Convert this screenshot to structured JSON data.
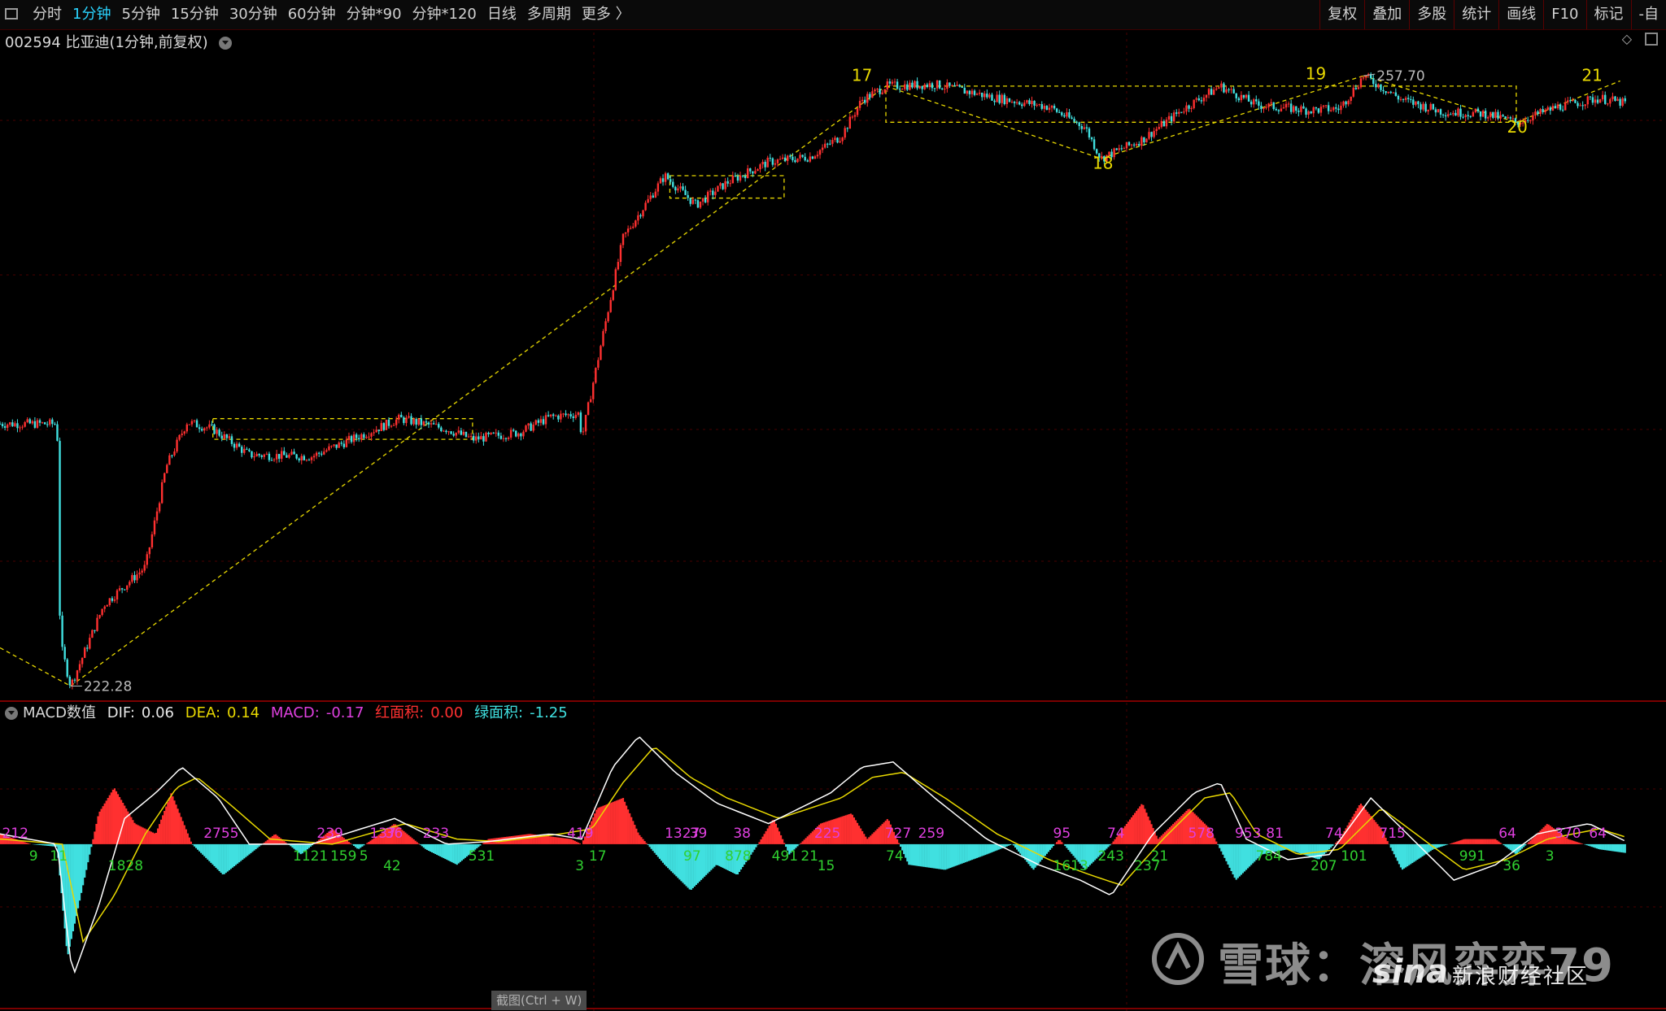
{
  "toolbar": {
    "periods": [
      "分时",
      "1分钟",
      "5分钟",
      "15分钟",
      "30分钟",
      "60分钟",
      "分钟*90",
      "分钟*120",
      "日线",
      "多周期",
      "更多 〉"
    ],
    "active_period": "1分钟",
    "tools": [
      "复权",
      "叠加",
      "多股",
      "统计",
      "画线",
      "F10",
      "标记",
      "-自"
    ]
  },
  "title": {
    "code": "002594",
    "name": "比亚迪(1分钟,前复权)"
  },
  "macd_header": {
    "name": "MACD数值",
    "dif_label": "DIF:",
    "dif": "0.06",
    "dea_label": "DEA:",
    "dea": "0.14",
    "macd_label": "MACD:",
    "macd": "-0.17",
    "red_label": "红面积:",
    "red": "0.00",
    "green_label": "绿面积:",
    "green": "-1.25"
  },
  "colors": {
    "up": "#ff3030",
    "down": "#40e0e0",
    "dif_line": "#ffffff",
    "dea_line": "#e8d800",
    "annotation": "#e8d800",
    "macd_red_label": "#e040e0",
    "macd_green_label": "#30d030",
    "grid": "#4a0000"
  },
  "chart_data": [
    {
      "type": "candlestick",
      "title": "002594 比亚迪(1分钟,前复权)",
      "price_labels": [
        {
          "label": "222.28",
          "kind": "low"
        },
        {
          "label": "257.70",
          "kind": "high"
        }
      ],
      "ylim": [
        221.5,
        259.5
      ],
      "path_points": [
        {
          "x": 0,
          "y": 237.5
        },
        {
          "x": 55,
          "y": 237.5
        },
        {
          "x": 58,
          "y": 224.8
        },
        {
          "x": 68,
          "y": 222.28
        },
        {
          "x": 100,
          "y": 227.0
        },
        {
          "x": 140,
          "y": 229.2
        },
        {
          "x": 160,
          "y": 235.0
        },
        {
          "x": 180,
          "y": 237.6
        },
        {
          "x": 205,
          "y": 237.2
        },
        {
          "x": 240,
          "y": 235.7
        },
        {
          "x": 300,
          "y": 235.6
        },
        {
          "x": 385,
          "y": 237.8
        },
        {
          "x": 430,
          "y": 237.2
        },
        {
          "x": 455,
          "y": 236.6
        },
        {
          "x": 500,
          "y": 237.0
        },
        {
          "x": 530,
          "y": 237.9
        },
        {
          "x": 558,
          "y": 238.1
        },
        {
          "x": 560,
          "y": 236.6
        },
        {
          "x": 580,
          "y": 242.5
        },
        {
          "x": 600,
          "y": 248.3
        },
        {
          "x": 640,
          "y": 251.9
        },
        {
          "x": 670,
          "y": 250.2
        },
        {
          "x": 700,
          "y": 251.5
        },
        {
          "x": 740,
          "y": 252.7
        },
        {
          "x": 780,
          "y": 253.0
        },
        {
          "x": 810,
          "y": 254.2
        },
        {
          "x": 830,
          "y": 256.3
        },
        {
          "x": 853,
          "y": 257.1
        },
        {
          "x": 900,
          "y": 257.2
        },
        {
          "x": 960,
          "y": 256.4
        },
        {
          "x": 1010,
          "y": 255.9
        },
        {
          "x": 1045,
          "y": 254.7
        },
        {
          "x": 1060,
          "y": 252.9
        },
        {
          "x": 1100,
          "y": 254.0
        },
        {
          "x": 1140,
          "y": 255.8
        },
        {
          "x": 1175,
          "y": 257.1
        },
        {
          "x": 1210,
          "y": 256.0
        },
        {
          "x": 1260,
          "y": 255.7
        },
        {
          "x": 1290,
          "y": 255.8
        },
        {
          "x": 1313,
          "y": 257.7
        },
        {
          "x": 1350,
          "y": 256.3
        },
        {
          "x": 1390,
          "y": 255.6
        },
        {
          "x": 1430,
          "y": 255.5
        },
        {
          "x": 1460,
          "y": 255.0
        },
        {
          "x": 1500,
          "y": 255.9
        },
        {
          "x": 1540,
          "y": 256.4
        },
        {
          "x": 1565,
          "y": 256.1
        }
      ],
      "annotations": [
        {
          "label": "17"
        },
        {
          "label": "18"
        },
        {
          "label": "19"
        },
        {
          "label": "20"
        },
        {
          "label": "21"
        }
      ]
    },
    {
      "type": "macd",
      "series": [
        {
          "name": "DIF",
          "color": "#ffffff"
        },
        {
          "name": "DEA",
          "color": "#e8d800"
        }
      ],
      "ylim": [
        -3.2,
        2.5
      ],
      "histogram_points": [
        {
          "x": 0,
          "y": 0.2
        },
        {
          "x": 30,
          "y": 0.0
        },
        {
          "x": 55,
          "y": -0.05
        },
        {
          "x": 65,
          "y": -2.2
        },
        {
          "x": 80,
          "y": -0.8
        },
        {
          "x": 95,
          "y": 0.6
        },
        {
          "x": 110,
          "y": 1.1
        },
        {
          "x": 130,
          "y": 0.4
        },
        {
          "x": 150,
          "y": 0.2
        },
        {
          "x": 165,
          "y": 1.0
        },
        {
          "x": 185,
          "y": 0.0
        },
        {
          "x": 215,
          "y": -0.6
        },
        {
          "x": 240,
          "y": -0.2
        },
        {
          "x": 265,
          "y": 0.2
        },
        {
          "x": 290,
          "y": -0.2
        },
        {
          "x": 320,
          "y": 0.3
        },
        {
          "x": 345,
          "y": -0.1
        },
        {
          "x": 380,
          "y": 0.4
        },
        {
          "x": 410,
          "y": -0.1
        },
        {
          "x": 440,
          "y": -0.4
        },
        {
          "x": 470,
          "y": 0.1
        },
        {
          "x": 510,
          "y": 0.2
        },
        {
          "x": 550,
          "y": 0.1
        },
        {
          "x": 560,
          "y": 0.0
        },
        {
          "x": 575,
          "y": 0.7
        },
        {
          "x": 600,
          "y": 0.9
        },
        {
          "x": 615,
          "y": 0.2
        },
        {
          "x": 640,
          "y": -0.4
        },
        {
          "x": 665,
          "y": -0.9
        },
        {
          "x": 690,
          "y": -0.4
        },
        {
          "x": 710,
          "y": -0.6
        },
        {
          "x": 730,
          "y": 0.0
        },
        {
          "x": 745,
          "y": 0.5
        },
        {
          "x": 760,
          "y": -0.2
        },
        {
          "x": 790,
          "y": 0.4
        },
        {
          "x": 820,
          "y": 0.6
        },
        {
          "x": 835,
          "y": 0.1
        },
        {
          "x": 855,
          "y": 0.5
        },
        {
          "x": 875,
          "y": -0.4
        },
        {
          "x": 910,
          "y": -0.5
        },
        {
          "x": 950,
          "y": -0.2
        },
        {
          "x": 975,
          "y": 0.0
        },
        {
          "x": 995,
          "y": -0.5
        },
        {
          "x": 1020,
          "y": 0.1
        },
        {
          "x": 1045,
          "y": -0.5
        },
        {
          "x": 1070,
          "y": 0.0
        },
        {
          "x": 1100,
          "y": 0.8
        },
        {
          "x": 1115,
          "y": 0.1
        },
        {
          "x": 1145,
          "y": 0.7
        },
        {
          "x": 1165,
          "y": 0.3
        },
        {
          "x": 1190,
          "y": -0.7
        },
        {
          "x": 1215,
          "y": -0.2
        },
        {
          "x": 1240,
          "y": -0.1
        },
        {
          "x": 1270,
          "y": -0.3
        },
        {
          "x": 1290,
          "y": 0.1
        },
        {
          "x": 1310,
          "y": 0.8
        },
        {
          "x": 1330,
          "y": 0.3
        },
        {
          "x": 1350,
          "y": -0.5
        },
        {
          "x": 1380,
          "y": -0.1
        },
        {
          "x": 1410,
          "y": 0.1
        },
        {
          "x": 1440,
          "y": 0.1
        },
        {
          "x": 1460,
          "y": -0.2
        },
        {
          "x": 1490,
          "y": 0.4
        },
        {
          "x": 1510,
          "y": 0.1
        },
        {
          "x": 1540,
          "y": -0.1
        },
        {
          "x": 1565,
          "y": -0.17
        }
      ],
      "dif_points": [
        {
          "x": 0,
          "y": 0.2
        },
        {
          "x": 55,
          "y": 0.0
        },
        {
          "x": 70,
          "y": -2.6
        },
        {
          "x": 95,
          "y": -1.2
        },
        {
          "x": 120,
          "y": 0.5
        },
        {
          "x": 150,
          "y": 1.0
        },
        {
          "x": 175,
          "y": 1.5
        },
        {
          "x": 210,
          "y": 0.9
        },
        {
          "x": 240,
          "y": 0.0
        },
        {
          "x": 300,
          "y": 0.0
        },
        {
          "x": 380,
          "y": 0.5
        },
        {
          "x": 430,
          "y": 0.0
        },
        {
          "x": 470,
          "y": 0.05
        },
        {
          "x": 530,
          "y": 0.2
        },
        {
          "x": 560,
          "y": 0.1
        },
        {
          "x": 590,
          "y": 1.5
        },
        {
          "x": 615,
          "y": 2.1
        },
        {
          "x": 650,
          "y": 1.4
        },
        {
          "x": 690,
          "y": 0.8
        },
        {
          "x": 740,
          "y": 0.4
        },
        {
          "x": 800,
          "y": 1.0
        },
        {
          "x": 830,
          "y": 1.5
        },
        {
          "x": 860,
          "y": 1.6
        },
        {
          "x": 900,
          "y": 0.9
        },
        {
          "x": 950,
          "y": 0.1
        },
        {
          "x": 1000,
          "y": -0.4
        },
        {
          "x": 1040,
          "y": -0.7
        },
        {
          "x": 1070,
          "y": -1.0
        },
        {
          "x": 1110,
          "y": 0.2
        },
        {
          "x": 1150,
          "y": 1.0
        },
        {
          "x": 1175,
          "y": 1.2
        },
        {
          "x": 1200,
          "y": 0.1
        },
        {
          "x": 1240,
          "y": -0.3
        },
        {
          "x": 1280,
          "y": -0.2
        },
        {
          "x": 1320,
          "y": 0.9
        },
        {
          "x": 1360,
          "y": 0.1
        },
        {
          "x": 1400,
          "y": -0.7
        },
        {
          "x": 1440,
          "y": -0.4
        },
        {
          "x": 1480,
          "y": 0.2
        },
        {
          "x": 1530,
          "y": 0.4
        },
        {
          "x": 1565,
          "y": 0.06
        }
      ],
      "dea_points": [
        {
          "x": 0,
          "y": 0.1
        },
        {
          "x": 60,
          "y": 0.0
        },
        {
          "x": 80,
          "y": -1.9
        },
        {
          "x": 110,
          "y": -1.0
        },
        {
          "x": 140,
          "y": 0.2
        },
        {
          "x": 170,
          "y": 1.1
        },
        {
          "x": 190,
          "y": 1.3
        },
        {
          "x": 220,
          "y": 0.8
        },
        {
          "x": 260,
          "y": 0.1
        },
        {
          "x": 320,
          "y": 0.0
        },
        {
          "x": 390,
          "y": 0.4
        },
        {
          "x": 440,
          "y": 0.1
        },
        {
          "x": 480,
          "y": 0.05
        },
        {
          "x": 540,
          "y": 0.2
        },
        {
          "x": 570,
          "y": 0.3
        },
        {
          "x": 600,
          "y": 1.2
        },
        {
          "x": 630,
          "y": 1.9
        },
        {
          "x": 665,
          "y": 1.3
        },
        {
          "x": 700,
          "y": 0.9
        },
        {
          "x": 750,
          "y": 0.5
        },
        {
          "x": 810,
          "y": 0.9
        },
        {
          "x": 840,
          "y": 1.3
        },
        {
          "x": 870,
          "y": 1.4
        },
        {
          "x": 910,
          "y": 0.9
        },
        {
          "x": 960,
          "y": 0.2
        },
        {
          "x": 1010,
          "y": -0.3
        },
        {
          "x": 1050,
          "y": -0.6
        },
        {
          "x": 1080,
          "y": -0.8
        },
        {
          "x": 1120,
          "y": 0.1
        },
        {
          "x": 1160,
          "y": 0.9
        },
        {
          "x": 1185,
          "y": 1.0
        },
        {
          "x": 1210,
          "y": 0.2
        },
        {
          "x": 1250,
          "y": -0.2
        },
        {
          "x": 1290,
          "y": -0.1
        },
        {
          "x": 1330,
          "y": 0.7
        },
        {
          "x": 1370,
          "y": 0.1
        },
        {
          "x": 1410,
          "y": -0.5
        },
        {
          "x": 1450,
          "y": -0.3
        },
        {
          "x": 1490,
          "y": 0.1
        },
        {
          "x": 1540,
          "y": 0.3
        },
        {
          "x": 1565,
          "y": 0.14
        }
      ],
      "area_labels": [
        {
          "label": "212",
          "sign": "pos"
        },
        {
          "label": "9",
          "sign": "neg"
        },
        {
          "label": "11",
          "sign": "neg"
        },
        {
          "label": "1828",
          "sign": "neg"
        },
        {
          "label": "2755",
          "sign": "pos"
        },
        {
          "label": "1121",
          "sign": "neg"
        },
        {
          "label": "239",
          "sign": "pos"
        },
        {
          "label": "159",
          "sign": "neg"
        },
        {
          "label": "5",
          "sign": "neg"
        },
        {
          "label": "42",
          "sign": "neg"
        },
        {
          "label": "137",
          "sign": "pos"
        },
        {
          "label": "36",
          "sign": "pos"
        },
        {
          "label": "233",
          "sign": "pos"
        },
        {
          "label": "531",
          "sign": "neg"
        },
        {
          "label": "419",
          "sign": "pos"
        },
        {
          "label": "3",
          "sign": "neg"
        },
        {
          "label": "17",
          "sign": "neg"
        },
        {
          "label": "1327",
          "sign": "pos"
        },
        {
          "label": "39",
          "sign": "pos"
        },
        {
          "label": "97",
          "sign": "neg"
        },
        {
          "label": "878",
          "sign": "neg"
        },
        {
          "label": "38",
          "sign": "pos"
        },
        {
          "label": "491",
          "sign": "neg"
        },
        {
          "label": "21",
          "sign": "neg"
        },
        {
          "label": "15",
          "sign": "neg"
        },
        {
          "label": "225",
          "sign": "pos"
        },
        {
          "label": "727",
          "sign": "pos"
        },
        {
          "label": "259",
          "sign": "pos"
        },
        {
          "label": "74",
          "sign": "neg"
        },
        {
          "label": "95",
          "sign": "pos"
        },
        {
          "label": "1613",
          "sign": "neg"
        },
        {
          "label": "243",
          "sign": "neg"
        },
        {
          "label": "74",
          "sign": "pos"
        },
        {
          "label": "237",
          "sign": "neg"
        },
        {
          "label": "21",
          "sign": "neg"
        },
        {
          "label": "578",
          "sign": "pos"
        },
        {
          "label": "953",
          "sign": "pos"
        },
        {
          "label": "784",
          "sign": "neg"
        },
        {
          "label": "81",
          "sign": "pos"
        },
        {
          "label": "207",
          "sign": "neg"
        },
        {
          "label": "74",
          "sign": "pos"
        },
        {
          "label": "101",
          "sign": "neg"
        },
        {
          "label": "715",
          "sign": "pos"
        },
        {
          "label": "991",
          "sign": "neg"
        },
        {
          "label": "64",
          "sign": "pos"
        },
        {
          "label": "36",
          "sign": "neg"
        },
        {
          "label": "3",
          "sign": "neg"
        },
        {
          "label": "370",
          "sign": "pos"
        },
        {
          "label": "64",
          "sign": "pos"
        }
      ]
    }
  ],
  "footer": {
    "screenshot_hint": "截图(Ctrl + W)",
    "watermark_main": "雪球：溶风弈弈79",
    "watermark_brand": "sina",
    "watermark_sub": "新浪财经社区"
  }
}
